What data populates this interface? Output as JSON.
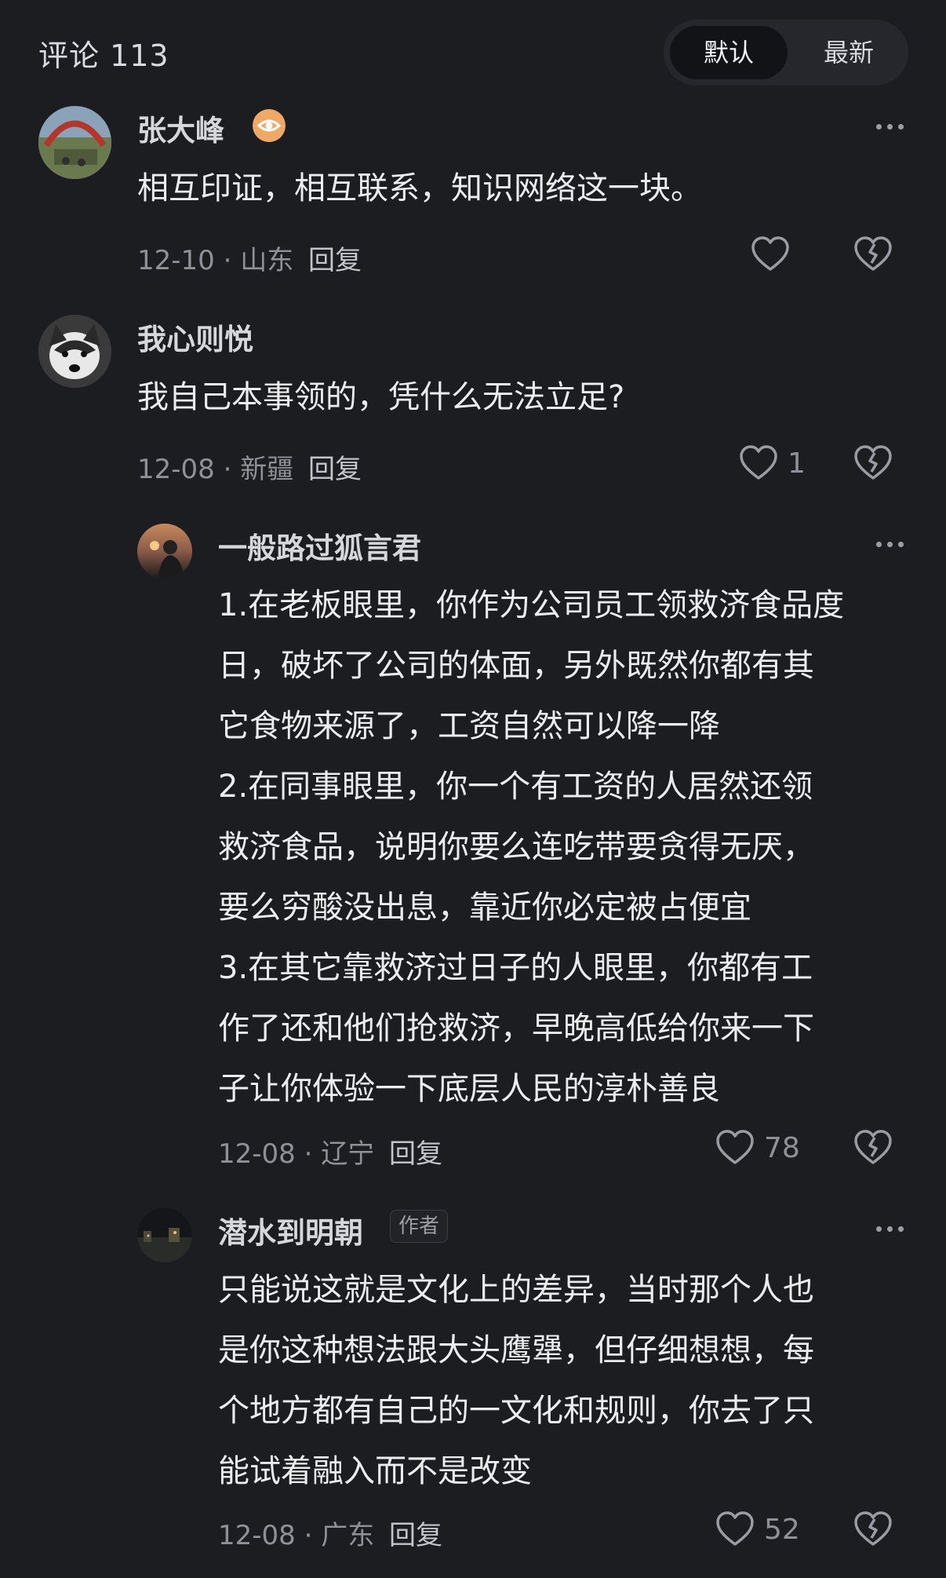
{
  "header": {
    "title": "评论 113",
    "sort_default": "默认",
    "sort_latest": "最新"
  },
  "comments": [
    {
      "username": "张大峰",
      "text": "相互印证，相互联系，知识网络这一块。",
      "date": "12-10",
      "location": "山东",
      "reply_label": "回复",
      "likes": ""
    },
    {
      "username": "我心则悦",
      "text": "我自己本事领的，凭什么无法立足?",
      "date": "12-08",
      "location": "新疆",
      "reply_label": "回复",
      "likes": "1"
    }
  ],
  "replies": [
    {
      "username": "一般路过狐言君",
      "text": "1.在老板眼里，你作为公司员工领救济食品度\n日，破坏了公司的体面，另外既然你都有其\n它食物来源了，工资自然可以降一降\n2.在同事眼里，你一个有工资的人居然还领\n救济食品，说明你要么连吃带要贪得无厌，\n要么穷酸没出息，靠近你必定被占便宜\n3.在其它靠救济过日子的人眼里，你都有工\n作了还和他们抢救济，早晚高低给你来一下\n子让你体验一下底层人民的淳朴善良",
      "date": "12-08",
      "location": "辽宁",
      "reply_label": "回复",
      "likes": "78"
    },
    {
      "username": "潜水到明朝",
      "author_badge": "作者",
      "text": "只能说这就是文化上的差异，当时那个人也\n是你这种想法跟大头鹰犟，但仔细想想，每\n个地方都有自己的一文化和规则，你去了只\n能试着融入而不是改变",
      "date": "12-08",
      "location": "广东",
      "reply_label": "回复",
      "likes": "52"
    }
  ],
  "meta_separator": "·",
  "colors": {
    "background": "#1c1d21",
    "badge_orange": "#f0a866",
    "secondary_text": "#8f9198"
  },
  "icons": [
    "eye-badge-icon",
    "more-icon",
    "heart-icon",
    "broken-heart-icon"
  ]
}
